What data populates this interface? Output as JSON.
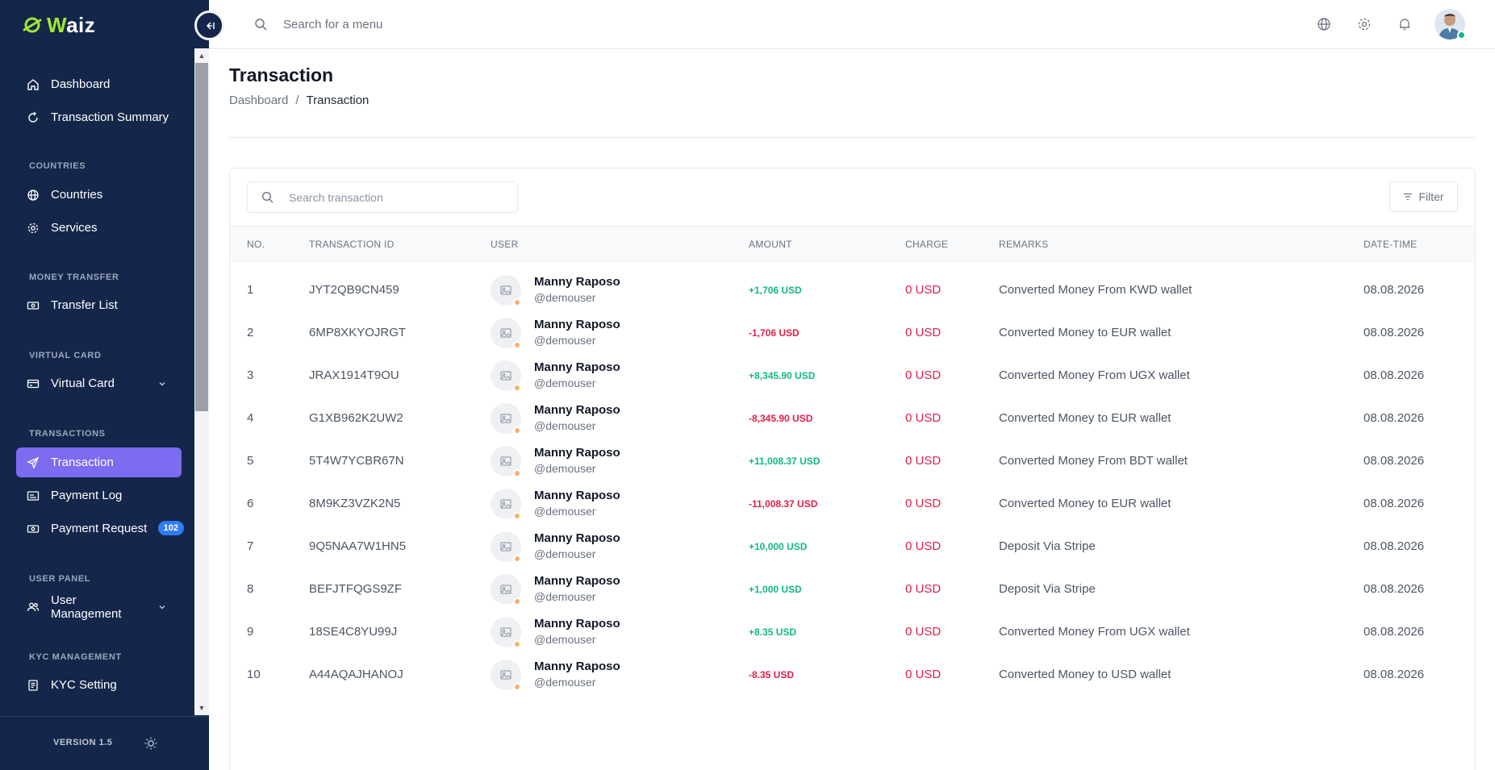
{
  "app": {
    "logo_text_a": "W",
    "logo_text_b": "aiz"
  },
  "sidebar": {
    "items": {
      "dashboard": "Dashboard",
      "transaction_summary": "Transaction Summary",
      "countries": "Countries",
      "services": "Services",
      "transfer_list": "Transfer List",
      "virtual_card": "Virtual Card",
      "transaction": "Transaction",
      "payment_log": "Payment Log",
      "payment_request": "Payment Request",
      "user_management": "User Management",
      "kyc_setting": "KYC Setting"
    },
    "sections": {
      "countries": "COUNTRIES",
      "money_transfer": "MONEY TRANSFER",
      "virtual_card": "VIRTUAL CARD",
      "transactions": "TRANSACTIONS",
      "user_panel": "USER PANEL",
      "kyc_management": "KYC MANAGEMENT"
    },
    "payment_request_badge": "102",
    "version": "VERSION 1.5",
    "active_color": "#7c6cf0",
    "background_color": "#14274a"
  },
  "topbar": {
    "search_placeholder": "Search for a menu"
  },
  "page": {
    "title": "Transaction",
    "breadcrumb": [
      "Dashboard",
      "Transaction"
    ],
    "breadcrumb_sep": "/"
  },
  "table": {
    "search_placeholder": "Search transaction",
    "filter_label": "Filter",
    "headers": [
      "NO.",
      "TRANSACTION ID",
      "USER",
      "AMOUNT",
      "CHARGE",
      "REMARKS",
      "DATE-TIME"
    ],
    "rows": [
      {
        "no": "1",
        "id": "JYT2QB9CN459",
        "name": "Manny Raposo",
        "handle": "@demouser",
        "amount": "+1,706 USD",
        "sign": "pos",
        "charge": "0 USD",
        "remarks": "Converted Money From KWD wallet",
        "date": "08.08.2026"
      },
      {
        "no": "2",
        "id": "6MP8XKYOJRGT",
        "name": "Manny Raposo",
        "handle": "@demouser",
        "amount": "-1,706 USD",
        "sign": "neg",
        "charge": "0 USD",
        "remarks": "Converted Money to EUR wallet",
        "date": "08.08.2026"
      },
      {
        "no": "3",
        "id": "JRAX1914T9OU",
        "name": "Manny Raposo",
        "handle": "@demouser",
        "amount": "+8,345.90 USD",
        "sign": "pos",
        "charge": "0 USD",
        "remarks": "Converted Money From UGX wallet",
        "date": "08.08.2026"
      },
      {
        "no": "4",
        "id": "G1XB962K2UW2",
        "name": "Manny Raposo",
        "handle": "@demouser",
        "amount": "-8,345.90 USD",
        "sign": "neg",
        "charge": "0 USD",
        "remarks": "Converted Money to EUR wallet",
        "date": "08.08.2026"
      },
      {
        "no": "5",
        "id": "5T4W7YCBR67N",
        "name": "Manny Raposo",
        "handle": "@demouser",
        "amount": "+11,008.37 USD",
        "sign": "pos",
        "charge": "0 USD",
        "remarks": "Converted Money From BDT wallet",
        "date": "08.08.2026"
      },
      {
        "no": "6",
        "id": "8M9KZ3VZK2N5",
        "name": "Manny Raposo",
        "handle": "@demouser",
        "amount": "-11,008.37 USD",
        "sign": "neg",
        "charge": "0 USD",
        "remarks": "Converted Money to EUR wallet",
        "date": "08.08.2026"
      },
      {
        "no": "7",
        "id": "9Q5NAA7W1HN5",
        "name": "Manny Raposo",
        "handle": "@demouser",
        "amount": "+10,000 USD",
        "sign": "pos",
        "charge": "0 USD",
        "remarks": "Deposit Via Stripe",
        "date": "08.08.2026"
      },
      {
        "no": "8",
        "id": "BEFJTFQGS9ZF",
        "name": "Manny Raposo",
        "handle": "@demouser",
        "amount": "+1,000 USD",
        "sign": "pos",
        "charge": "0 USD",
        "remarks": "Deposit Via Stripe",
        "date": "08.08.2026"
      },
      {
        "no": "9",
        "id": "18SE4C8YU99J",
        "name": "Manny Raposo",
        "handle": "@demouser",
        "amount": "+8.35 USD",
        "sign": "pos",
        "charge": "0 USD",
        "remarks": "Converted Money From UGX wallet",
        "date": "08.08.2026"
      },
      {
        "no": "10",
        "id": "A44AQAJHANOJ",
        "name": "Manny Raposo",
        "handle": "@demouser",
        "amount": "-8.35 USD",
        "sign": "neg",
        "charge": "0 USD",
        "remarks": "Converted Money to USD wallet",
        "date": "08.08.2026"
      }
    ]
  },
  "colors": {
    "positive": "#10b981",
    "negative": "#e11d48",
    "badge": "#2f7cf6"
  }
}
